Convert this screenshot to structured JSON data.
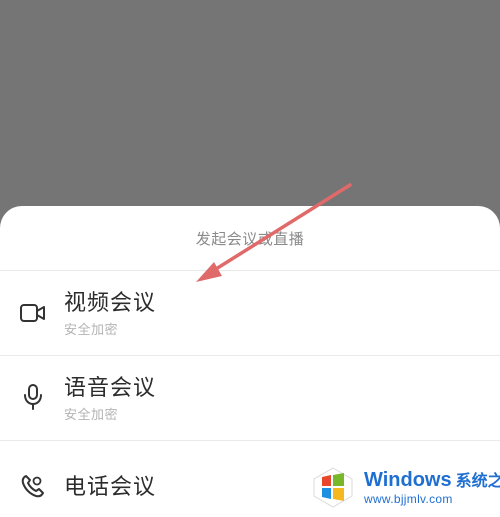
{
  "sheet": {
    "title": "发起会议或直播"
  },
  "options": [
    {
      "title": "视频会议",
      "subtitle": "安全加密",
      "icon": "video-camera-icon"
    },
    {
      "title": "语音会议",
      "subtitle": "安全加密",
      "icon": "microphone-icon"
    },
    {
      "title": "电话会议",
      "subtitle": "",
      "icon": "phone-icon"
    }
  ],
  "annotation": {
    "arrow_color": "#e06a6a",
    "points_to": "视频会议"
  },
  "watermark": {
    "brand": "Windows",
    "brand_cn": "系统之家",
    "url": "www.bjjmlv.com"
  },
  "colors": {
    "overlay": "#757575",
    "sheet": "#ffffff",
    "title_text": "#8a8a8a",
    "option_text": "#2c2c2c",
    "subtitle_text": "#b3b3b3",
    "watermark_blue": "#1f6fd1"
  }
}
